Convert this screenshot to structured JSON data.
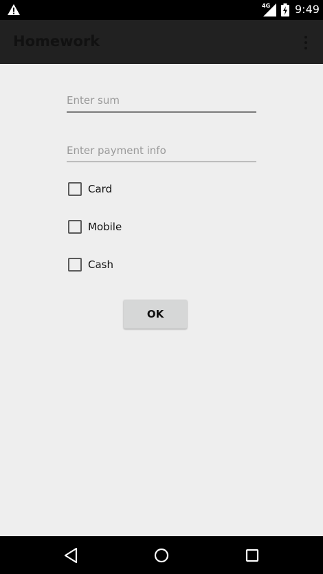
{
  "status_bar": {
    "time": "9:49",
    "network_label": "4G",
    "icons": [
      "warning-icon",
      "signal-icon",
      "battery-charging-icon"
    ]
  },
  "app_bar": {
    "title": "Homework",
    "overflow_icon": "more-vert-icon"
  },
  "form": {
    "sum_field": {
      "placeholder": "Enter sum",
      "value": ""
    },
    "payment_field": {
      "placeholder": "Enter payment info",
      "value": ""
    },
    "checkboxes": [
      {
        "label": "Card",
        "checked": false
      },
      {
        "label": "Mobile",
        "checked": false
      },
      {
        "label": "Cash",
        "checked": false
      }
    ],
    "ok_label": "OK"
  },
  "nav_bar": {
    "icons": [
      "back-icon",
      "home-icon",
      "recents-icon"
    ]
  }
}
